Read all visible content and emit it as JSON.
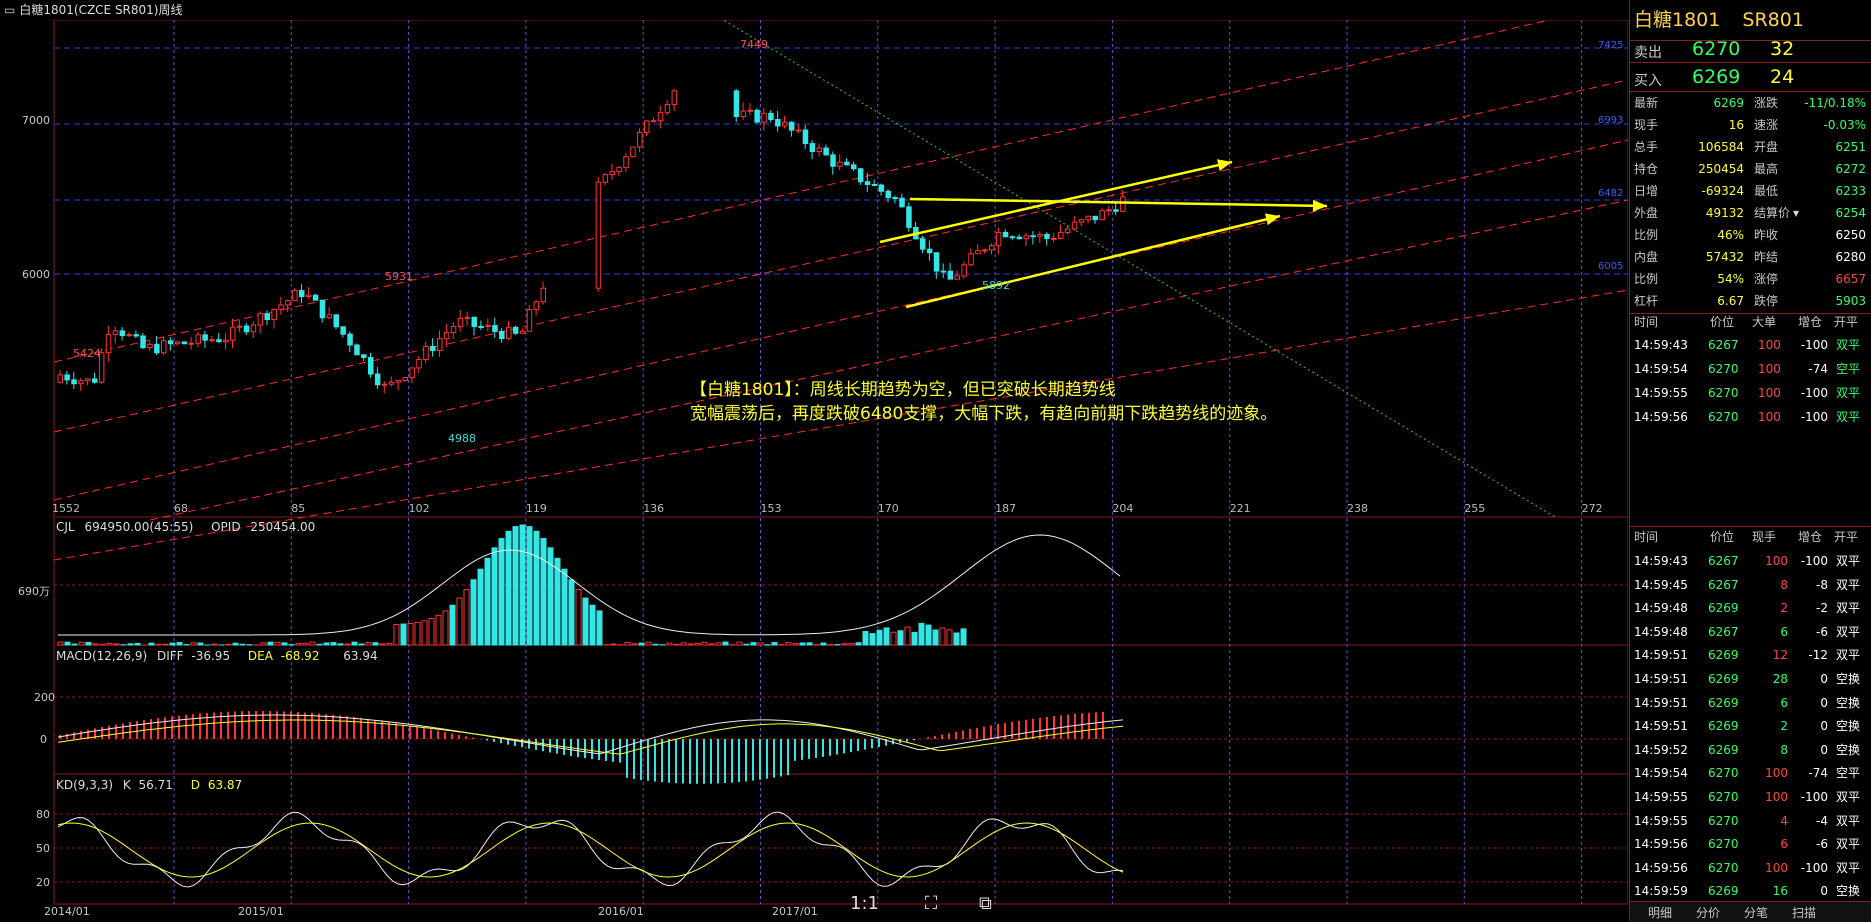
{
  "window": {
    "title": "白糖1801(CZCE SR801)周线",
    "menu_icon": "minus-box-icon"
  },
  "main_chart": {
    "y_labels": [
      "7000",
      "6000"
    ],
    "x_counts": [
      "68",
      "85",
      "102",
      "119",
      "136",
      "153",
      "170",
      "187",
      "204",
      "221",
      "238",
      "255",
      "272"
    ],
    "x_first": "1552",
    "price_labels": {
      "high": "7449",
      "p5931": "5931",
      "p5424": "5424",
      "p4988": "4988",
      "p5892": "5892"
    },
    "right_tags": [
      "7425",
      "6993",
      "6482",
      "6005"
    ],
    "annotation_line1_a": "【白糖1801】",
    "annotation_line1_b": "：周线长期趋势为空，但已突破长期趋势线",
    "annotation_line2": "宽幅震荡后，再度跌破6480支撑，大幅下跌，有趋向前期下跌趋势线的迹象。"
  },
  "volume_panel": {
    "label": "CJL",
    "value": "694950.00(45:55)",
    "opid_label": "OPID",
    "opid_value": "250454.00",
    "y_label": "690万"
  },
  "macd_panel": {
    "label": "MACD(12,26,9)",
    "diff_label": "DIFF",
    "diff_value": "-36.95",
    "dea_label": "DEA",
    "dea_value": "-68.92",
    "macd_value": "63.94",
    "y_labels": [
      "200",
      "0"
    ]
  },
  "kd_panel": {
    "label": "KD(9,3,3)",
    "k_label": "K",
    "k_value": "56.71",
    "d_label": "D",
    "d_value": "63.87",
    "y_labels": [
      "80",
      "50",
      "20"
    ]
  },
  "x_dates": [
    "2014/01",
    "2015/01",
    "2016/01",
    "2017/01"
  ],
  "toolbar": {
    "zoom_label": "1:1",
    "fit_icon": "fit-screen-icon",
    "export_icon": "export-icon"
  },
  "quote": {
    "name": "白糖1801",
    "code": "SR801",
    "sell_label": "卖出",
    "sell_price": "6270",
    "sell_vol": "32",
    "buy_label": "买入",
    "buy_price": "6269",
    "buy_vol": "24",
    "fields": [
      {
        "l1": "最新",
        "v1": "6269",
        "c1": "grn",
        "l2": "涨跌",
        "v2": "-11/0.18%",
        "c2": "grn"
      },
      {
        "l1": "现手",
        "v1": "16",
        "c1": "yel",
        "l2": "速涨",
        "v2": "-0.03%",
        "c2": "grn"
      },
      {
        "l1": "总手",
        "v1": "106584",
        "c1": "yel",
        "l2": "开盘",
        "v2": "6251",
        "c2": "grn"
      },
      {
        "l1": "持仓",
        "v1": "250454",
        "c1": "yel",
        "l2": "最高",
        "v2": "6272",
        "c2": "grn"
      },
      {
        "l1": "日增",
        "v1": "-69324",
        "c1": "yel",
        "l2": "最低",
        "v2": "6233",
        "c2": "grn"
      },
      {
        "l1": "外盘",
        "v1": "49132",
        "c1": "yel",
        "l2": "结算价",
        "v2": "6254",
        "c2": "grn"
      },
      {
        "l1": "比例",
        "v1": "46%",
        "c1": "yel",
        "l2": "昨收",
        "v2": "6250",
        "c2": "wht"
      },
      {
        "l1": "内盘",
        "v1": "57432",
        "c1": "yel",
        "l2": "昨结",
        "v2": "6280",
        "c2": "wht"
      },
      {
        "l1": "比例",
        "v1": "54%",
        "c1": "yel",
        "l2": "涨停",
        "v2": "6657",
        "c2": "red"
      },
      {
        "l1": "杠杆",
        "v1": "6.67",
        "c1": "yel",
        "l2": "跌停",
        "v2": "5903",
        "c2": "grn"
      }
    ],
    "settle_dropdown_icon": "caret-down-icon"
  },
  "big_orders": {
    "headers": [
      "时间",
      "价位",
      "大单",
      "增仓",
      "开平"
    ],
    "rows": [
      {
        "t": "14:59:43",
        "p": "6267",
        "v": "100",
        "d": "-100",
        "k": "双平",
        "kc": "grn"
      },
      {
        "t": "14:59:54",
        "p": "6270",
        "v": "100",
        "d": "-74",
        "k": "空平",
        "kc": "grn"
      },
      {
        "t": "14:59:55",
        "p": "6270",
        "v": "100",
        "d": "-100",
        "k": "双平",
        "kc": "grn"
      },
      {
        "t": "14:59:56",
        "p": "6270",
        "v": "100",
        "d": "-100",
        "k": "双平",
        "kc": "grn"
      }
    ]
  },
  "ticks": {
    "headers": [
      "时间",
      "价位",
      "现手",
      "增仓",
      "开平"
    ],
    "rows": [
      {
        "t": "14:59:43",
        "p": "6267",
        "v": "100",
        "vc": "red",
        "d": "-100",
        "k": "双平"
      },
      {
        "t": "14:59:45",
        "p": "6267",
        "v": "8",
        "vc": "red",
        "d": "-8",
        "k": "双平"
      },
      {
        "t": "14:59:48",
        "p": "6269",
        "v": "2",
        "vc": "red",
        "d": "-2",
        "k": "双平"
      },
      {
        "t": "14:59:48",
        "p": "6267",
        "v": "6",
        "vc": "grn",
        "d": "-6",
        "k": "双平"
      },
      {
        "t": "14:59:51",
        "p": "6269",
        "v": "12",
        "vc": "red",
        "d": "-12",
        "k": "双平"
      },
      {
        "t": "14:59:51",
        "p": "6269",
        "v": "28",
        "vc": "grn",
        "d": "0",
        "k": "空换"
      },
      {
        "t": "14:59:51",
        "p": "6269",
        "v": "6",
        "vc": "grn",
        "d": "0",
        "k": "空换"
      },
      {
        "t": "14:59:51",
        "p": "6269",
        "v": "2",
        "vc": "grn",
        "d": "0",
        "k": "空换"
      },
      {
        "t": "14:59:52",
        "p": "6269",
        "v": "8",
        "vc": "grn",
        "d": "0",
        "k": "空换"
      },
      {
        "t": "14:59:54",
        "p": "6270",
        "v": "100",
        "vc": "red",
        "d": "-74",
        "k": "空平"
      },
      {
        "t": "14:59:55",
        "p": "6270",
        "v": "100",
        "vc": "red",
        "d": "-100",
        "k": "双平"
      },
      {
        "t": "14:59:55",
        "p": "6270",
        "v": "4",
        "vc": "red",
        "d": "-4",
        "k": "双平"
      },
      {
        "t": "14:59:56",
        "p": "6270",
        "v": "6",
        "vc": "red",
        "d": "-6",
        "k": "双平"
      },
      {
        "t": "14:59:56",
        "p": "6270",
        "v": "100",
        "vc": "red",
        "d": "-100",
        "k": "双平"
      },
      {
        "t": "14:59:59",
        "p": "6269",
        "v": "16",
        "vc": "grn",
        "d": "0",
        "k": "空换"
      }
    ]
  },
  "bottom_tabs": [
    "明细",
    "分价",
    "分笔",
    "扫描"
  ],
  "colors": {
    "up": "#ff3333",
    "down": "#33e6e6",
    "trend": "#ff2a2a",
    "arrow": "#ffff00",
    "bg": "#000000"
  }
}
